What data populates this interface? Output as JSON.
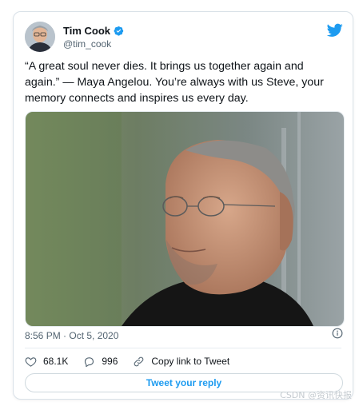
{
  "tweet": {
    "author": {
      "display_name": "Tim Cook",
      "handle": "@tim_cook",
      "verified": true
    },
    "text_lines": [
      "“A great soul never dies. It brings us together again and",
      "again.” — Maya Angelou. You’re always with us Steve, your",
      "memory connects and inspires us every day."
    ],
    "timestamp": "8:56 PM · Oct 5, 2020",
    "actions": {
      "like_count": "68.1K",
      "reply_count": "996",
      "copy_link_label": "Copy link to Tweet"
    },
    "reply_button_label": "Tweet your reply"
  },
  "colors": {
    "accent": "#1d9bf0",
    "text_primary": "#0f1419",
    "text_secondary": "#536471"
  },
  "icons": [
    "verified-badge-icon",
    "twitter-bird-icon",
    "info-icon",
    "heart-icon",
    "reply-bubble-icon",
    "link-icon"
  ],
  "watermark": "CSDN @资讯快报"
}
